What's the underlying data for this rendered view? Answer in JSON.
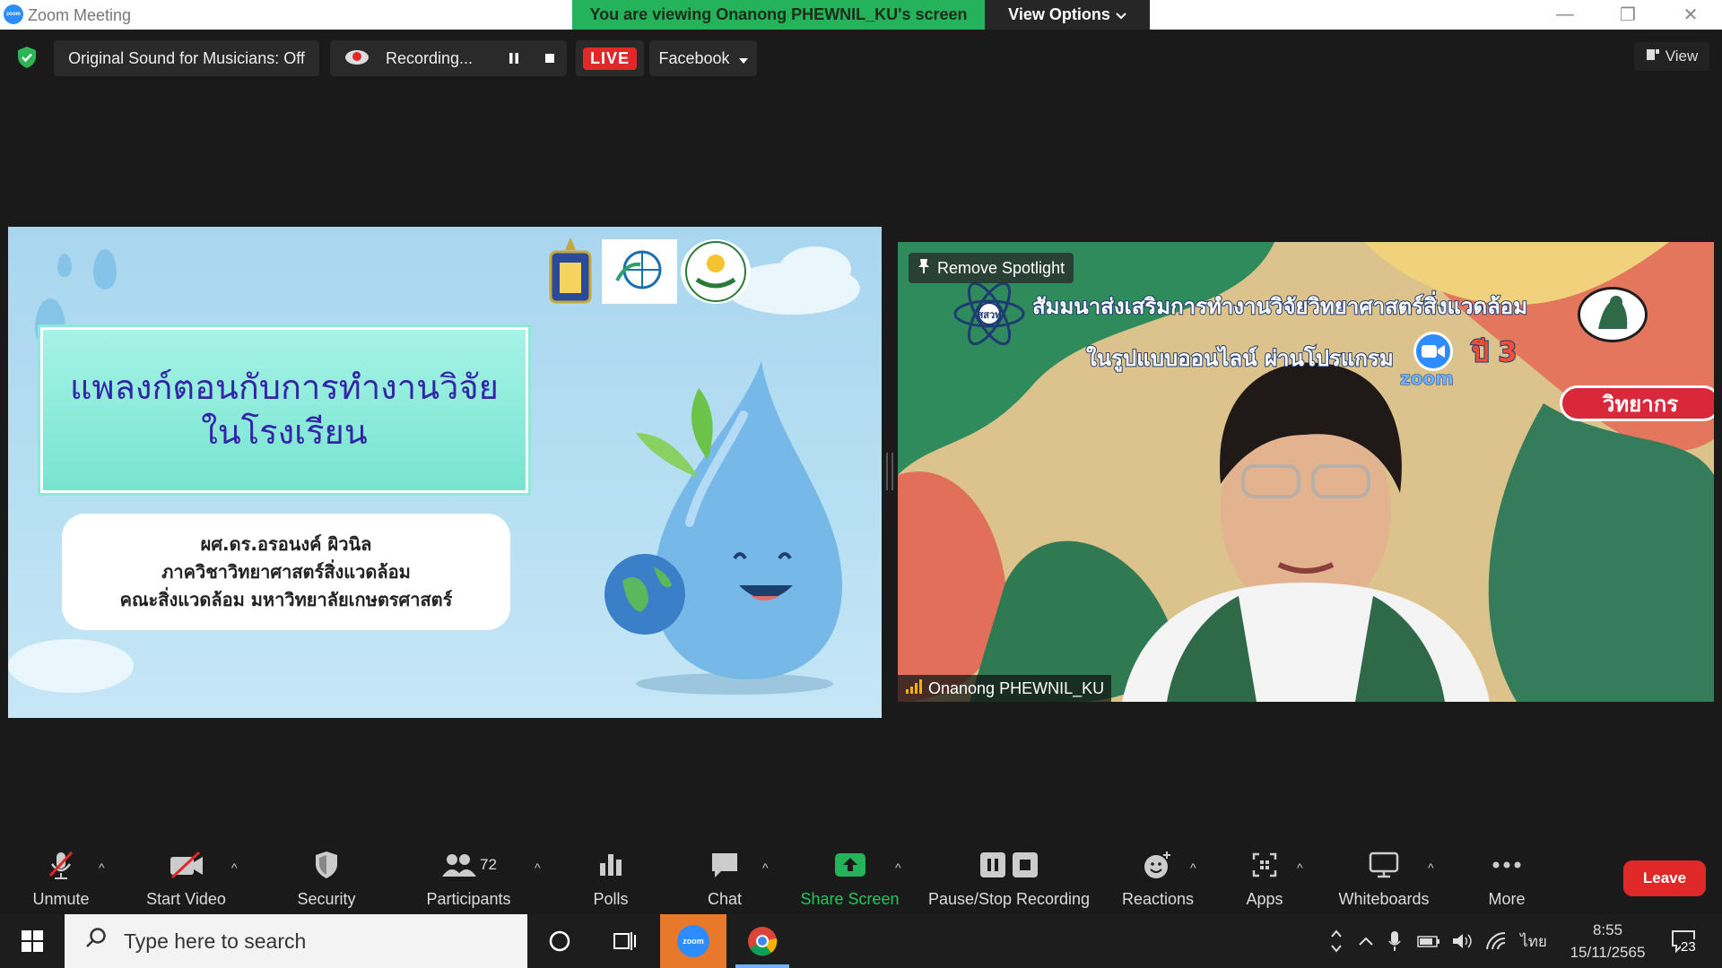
{
  "window": {
    "app_title": "Zoom Meeting",
    "app_logo_text": "zoom",
    "share_banner": "You are viewing Onanong PHEWNIL_KU's screen",
    "view_options": "View Options",
    "controls": {
      "minimize": "—",
      "restore": "❐",
      "close": "✕"
    }
  },
  "status_bar": {
    "original_sound": "Original Sound for Musicians: Off",
    "recording": "Recording...",
    "live": "LIVE",
    "facebook": "Facebook",
    "view": "View"
  },
  "slide": {
    "title_line1": "แพลงก์ตอนกับการทำงานวิจัย",
    "title_line2": "ในโรงเรียน",
    "author_line1": "ผศ.ดร.อรอนงค์  ผิวนิล",
    "author_line2": "ภาควิชาวิทยาศาสตร์สิ่งแวดล้อม",
    "author_line3": "คณะสิ่งแวดล้อม มหาวิทยาลัยเกษตรศาสตร์"
  },
  "video": {
    "remove_spotlight": "Remove Spotlight",
    "participant_name": "Onanong PHEWNIL_KU",
    "banner_line1": "สัมมนาส่งเสริมการทำงานวิจัยวิทยาศาสตร์สิ่งแวดล้อม",
    "banner_line2": "ในรูปแบบออนไลน์ ผ่านโปรแกรม",
    "banner_year": "ปี 3",
    "zoom_word": "zoom",
    "speaker_label": "วิทยากร",
    "logo_text": "สสวท"
  },
  "toolbar": {
    "unmute": "Unmute",
    "start_video": "Start Video",
    "security": "Security",
    "participants": "Participants",
    "participant_count": "72",
    "polls": "Polls",
    "chat": "Chat",
    "share_screen": "Share Screen",
    "pause_stop_recording": "Pause/Stop Recording",
    "reactions": "Reactions",
    "apps": "Apps",
    "whiteboards": "Whiteboards",
    "more": "More",
    "leave": "Leave",
    "caret": "^"
  },
  "taskbar": {
    "search_placeholder": "Type here to search",
    "zoom_app": "zoom",
    "language": "ไทย",
    "time": "8:55",
    "date": "15/11/2565",
    "notification_count": "23"
  },
  "colors": {
    "share_green": "#24b35a",
    "live_red": "#e02828",
    "zoom_blue": "#2d8cff",
    "slide_title": "#3325a8"
  }
}
